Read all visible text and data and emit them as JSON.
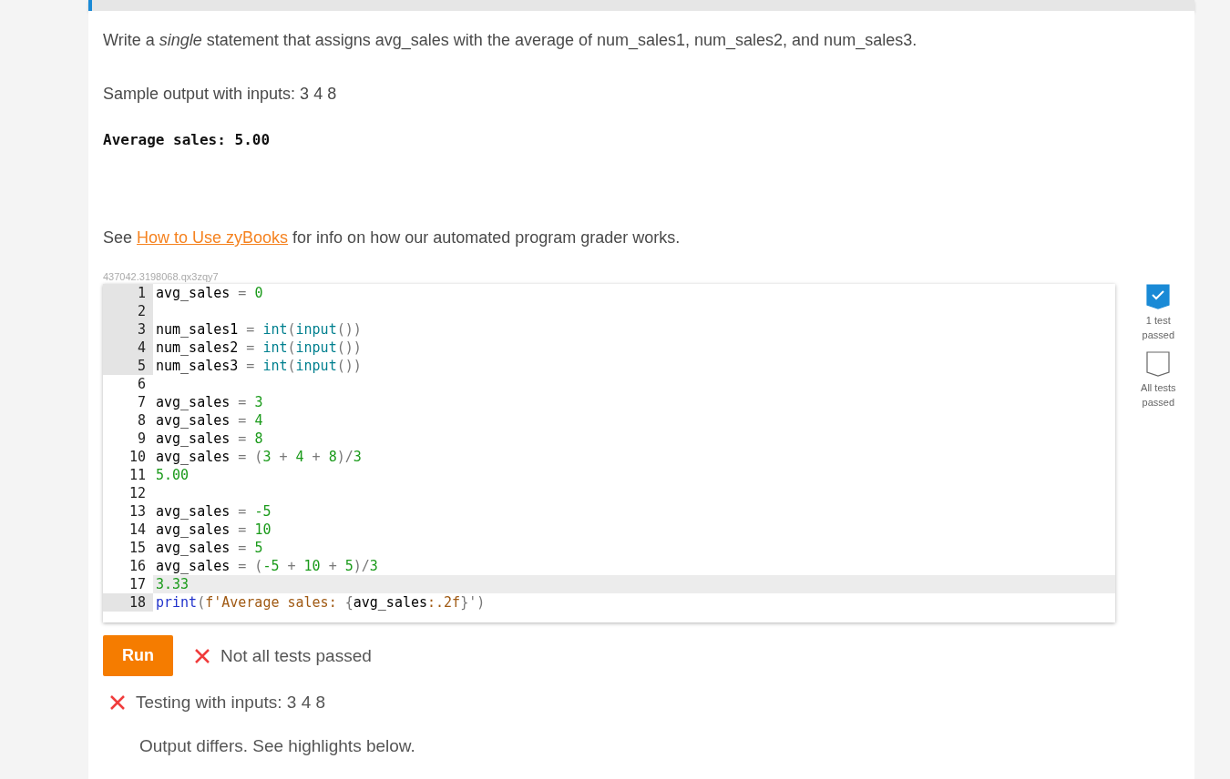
{
  "prompt": "Write a *single* statement that assigns avg_sales with the average of num_sales1, num_sales2, and num_sales3.",
  "sample_label": "Sample output with inputs: 3 4 8",
  "sample_output": "Average sales: 5.00",
  "help": {
    "before": "See ",
    "link": "How to Use zyBooks",
    "after": " for info on how our automated program grader works."
  },
  "exercise_id": "437042.3198068.qx3zqy7",
  "code_lines": [
    {
      "number": "1",
      "readonly": true,
      "active": false,
      "tokens": [
        {
          "text": "avg_sales ",
          "kind": "plain"
        },
        {
          "text": "= ",
          "kind": "op"
        },
        {
          "text": "0",
          "kind": "num"
        }
      ]
    },
    {
      "number": "2",
      "readonly": true,
      "active": false
    },
    {
      "number": "3",
      "readonly": true,
      "active": false,
      "tokens": [
        {
          "text": "num_sales1 ",
          "kind": "plain"
        },
        {
          "text": "= ",
          "kind": "op"
        },
        {
          "text": "int",
          "kind": "builtin"
        },
        {
          "text": "(",
          "kind": "op"
        },
        {
          "text": "input",
          "kind": "builtin"
        },
        {
          "text": "())",
          "kind": "op"
        }
      ]
    },
    {
      "number": "4",
      "readonly": true,
      "active": false,
      "tokens": [
        {
          "text": "num_sales2 ",
          "kind": "plain"
        },
        {
          "text": "= ",
          "kind": "op"
        },
        {
          "text": "int",
          "kind": "builtin"
        },
        {
          "text": "(",
          "kind": "op"
        },
        {
          "text": "input",
          "kind": "builtin"
        },
        {
          "text": "())",
          "kind": "op"
        }
      ]
    },
    {
      "number": "5",
      "readonly": true,
      "active": false,
      "tokens": [
        {
          "text": "num_sales3 ",
          "kind": "plain"
        },
        {
          "text": "= ",
          "kind": "op"
        },
        {
          "text": "int",
          "kind": "builtin"
        },
        {
          "text": "(",
          "kind": "op"
        },
        {
          "text": "input",
          "kind": "builtin"
        },
        {
          "text": "())",
          "kind": "op"
        }
      ]
    },
    {
      "number": "6",
      "readonly": false,
      "active": false
    },
    {
      "number": "7",
      "readonly": false,
      "active": false,
      "tokens": [
        {
          "text": "avg_sales ",
          "kind": "plain"
        },
        {
          "text": "= ",
          "kind": "op"
        },
        {
          "text": "3",
          "kind": "num"
        }
      ]
    },
    {
      "number": "8",
      "readonly": false,
      "active": false,
      "tokens": [
        {
          "text": "avg_sales ",
          "kind": "plain"
        },
        {
          "text": "= ",
          "kind": "op"
        },
        {
          "text": "4",
          "kind": "num"
        }
      ]
    },
    {
      "number": "9",
      "readonly": false,
      "active": false,
      "tokens": [
        {
          "text": "avg_sales ",
          "kind": "plain"
        },
        {
          "text": "= ",
          "kind": "op"
        },
        {
          "text": "8",
          "kind": "num"
        }
      ]
    },
    {
      "number": "10",
      "readonly": false,
      "active": false,
      "tokens": [
        {
          "text": "avg_sales ",
          "kind": "plain"
        },
        {
          "text": "= (",
          "kind": "op"
        },
        {
          "text": "3",
          "kind": "num"
        },
        {
          "text": " + ",
          "kind": "op"
        },
        {
          "text": "4",
          "kind": "num"
        },
        {
          "text": " + ",
          "kind": "op"
        },
        {
          "text": "8",
          "kind": "num"
        },
        {
          "text": ")/",
          "kind": "op"
        },
        {
          "text": "3",
          "kind": "num"
        }
      ]
    },
    {
      "number": "11",
      "readonly": false,
      "active": false,
      "tokens": [
        {
          "text": "5.00",
          "kind": "num"
        }
      ]
    },
    {
      "number": "12",
      "readonly": false,
      "active": false
    },
    {
      "number": "13",
      "readonly": false,
      "active": false,
      "tokens": [
        {
          "text": "avg_sales ",
          "kind": "plain"
        },
        {
          "text": "= ",
          "kind": "op"
        },
        {
          "text": "-5",
          "kind": "num"
        }
      ]
    },
    {
      "number": "14",
      "readonly": false,
      "active": false,
      "tokens": [
        {
          "text": "avg_sales ",
          "kind": "plain"
        },
        {
          "text": "= ",
          "kind": "op"
        },
        {
          "text": "10",
          "kind": "num"
        }
      ]
    },
    {
      "number": "15",
      "readonly": false,
      "active": false,
      "tokens": [
        {
          "text": "avg_sales ",
          "kind": "plain"
        },
        {
          "text": "= ",
          "kind": "op"
        },
        {
          "text": "5",
          "kind": "num"
        }
      ]
    },
    {
      "number": "16",
      "readonly": false,
      "active": false,
      "tokens": [
        {
          "text": "avg_sales ",
          "kind": "plain"
        },
        {
          "text": "= (",
          "kind": "op"
        },
        {
          "text": "-5",
          "kind": "num"
        },
        {
          "text": " + ",
          "kind": "op"
        },
        {
          "text": "10",
          "kind": "num"
        },
        {
          "text": " + ",
          "kind": "op"
        },
        {
          "text": "5",
          "kind": "num"
        },
        {
          "text": ")/",
          "kind": "op"
        },
        {
          "text": "3",
          "kind": "num"
        }
      ]
    },
    {
      "number": "17",
      "readonly": false,
      "active": true,
      "tokens": [
        {
          "text": "3.33",
          "kind": "num"
        }
      ]
    },
    {
      "number": "18",
      "readonly": true,
      "active": false,
      "tokens": [
        {
          "text": "print",
          "kind": "builtin2"
        },
        {
          "text": "(",
          "kind": "op"
        },
        {
          "text": "f'Average sales: ",
          "kind": "string"
        },
        {
          "text": "{",
          "kind": "op"
        },
        {
          "text": "avg_sales",
          "kind": "plain"
        },
        {
          "text": ":.2f",
          "kind": "string"
        },
        {
          "text": "}",
          "kind": "op"
        },
        {
          "text": "')",
          "kind": "op"
        }
      ]
    }
  ],
  "test_badges": [
    {
      "label": "1 test passed",
      "checked": true
    },
    {
      "label": "All tests passed",
      "checked": false
    }
  ],
  "run_button": "Run",
  "result": {
    "passed": false,
    "text": "Not all tests passed"
  },
  "tests": [
    {
      "passed": false,
      "label": "Testing with inputs: 3 4 8",
      "message": "Output differs. See highlights below."
    }
  ]
}
